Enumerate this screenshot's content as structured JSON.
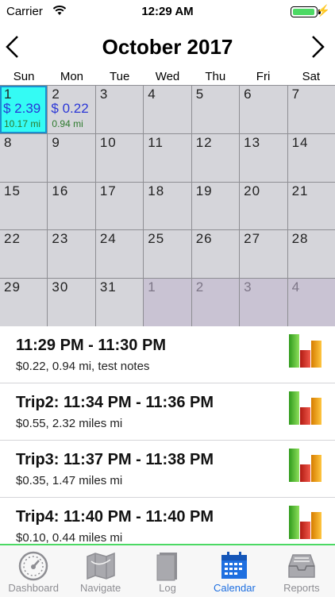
{
  "status": {
    "carrier": "Carrier",
    "time": "12:29 AM",
    "battery_level": 0.95
  },
  "calendar": {
    "month_title": "October 2017",
    "weekdays": [
      "Sun",
      "Mon",
      "Tue",
      "Wed",
      "Thu",
      "Fri",
      "Sat"
    ],
    "days": [
      {
        "day": "1",
        "amount": "$ 2.39",
        "miles": "10.17 mi",
        "today": true
      },
      {
        "day": "2",
        "amount": "$ 0.22",
        "miles": "0.94 mi"
      },
      {
        "day": "3"
      },
      {
        "day": "4"
      },
      {
        "day": "5"
      },
      {
        "day": "6"
      },
      {
        "day": "7"
      },
      {
        "day": "8"
      },
      {
        "day": "9"
      },
      {
        "day": "10"
      },
      {
        "day": "11"
      },
      {
        "day": "12"
      },
      {
        "day": "13"
      },
      {
        "day": "14"
      },
      {
        "day": "15"
      },
      {
        "day": "16"
      },
      {
        "day": "17"
      },
      {
        "day": "18"
      },
      {
        "day": "19"
      },
      {
        "day": "20"
      },
      {
        "day": "21"
      },
      {
        "day": "22"
      },
      {
        "day": "23"
      },
      {
        "day": "24"
      },
      {
        "day": "25"
      },
      {
        "day": "26"
      },
      {
        "day": "27"
      },
      {
        "day": "28"
      },
      {
        "day": "29"
      },
      {
        "day": "30"
      },
      {
        "day": "31"
      },
      {
        "day": "1",
        "other": true
      },
      {
        "day": "2",
        "other": true
      },
      {
        "day": "3",
        "other": true
      },
      {
        "day": "4",
        "other": true
      }
    ]
  },
  "trips": [
    {
      "title": "11:29 PM - 11:30 PM",
      "subtitle": "$0.22, 0.94 mi, test notes"
    },
    {
      "title": "Trip2: 11:34 PM - 11:36 PM",
      "subtitle": "$0.55, 2.32 miles mi"
    },
    {
      "title": "Trip3: 11:37 PM - 11:38 PM",
      "subtitle": "$0.35, 1.47 miles mi"
    },
    {
      "title": "Trip4: 11:40 PM - 11:40 PM",
      "subtitle": "$0.10, 0.44 miles mi"
    }
  ],
  "tabs": [
    {
      "label": "Dashboard",
      "icon": "dashboard-gauge-icon"
    },
    {
      "label": "Navigate",
      "icon": "map-icon"
    },
    {
      "label": "Log",
      "icon": "book-icon"
    },
    {
      "label": "Calendar",
      "icon": "calendar-icon",
      "active": true
    },
    {
      "label": "Reports",
      "icon": "inbox-tray-icon"
    }
  ],
  "colors": {
    "accent": "#1e6fe0",
    "today": "#34fbf4",
    "amount": "#2b37d6",
    "miles": "#2d7a2d",
    "tab_border": "#4cd964"
  }
}
